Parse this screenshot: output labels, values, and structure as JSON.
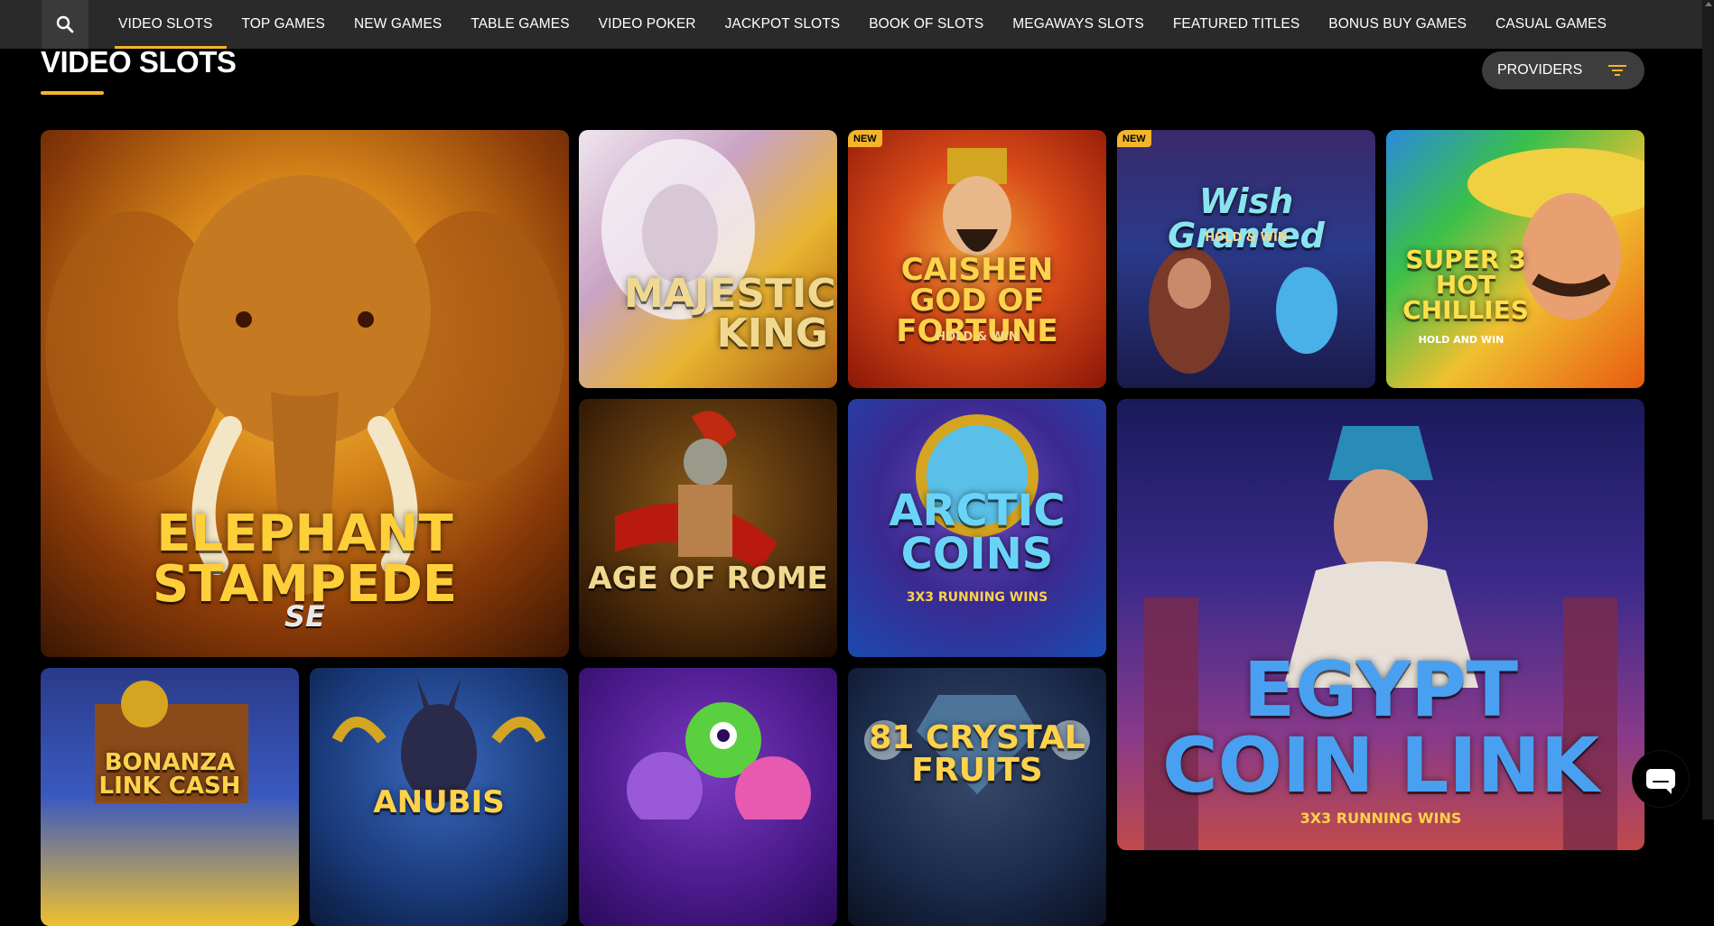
{
  "nav": {
    "search_icon": "search-icon",
    "items": [
      {
        "label": "VIDEO SLOTS"
      },
      {
        "label": "TOP GAMES"
      },
      {
        "label": "NEW GAMES"
      },
      {
        "label": "TABLE GAMES"
      },
      {
        "label": "VIDEO POKER"
      },
      {
        "label": "JACKPOT SLOTS"
      },
      {
        "label": "BOOK OF SLOTS"
      },
      {
        "label": "MEGAWAYS SLOTS"
      },
      {
        "label": "FEATURED TITLES"
      },
      {
        "label": "BONUS BUY GAMES"
      },
      {
        "label": "CASUAL GAMES"
      }
    ],
    "active_index": 0
  },
  "page": {
    "title": "VIDEO SLOTS",
    "providers_label": "PROVIDERS",
    "providers_icon": "filter-icon"
  },
  "colors": {
    "accent": "#f5b52a",
    "nav_bg": "#2a2a2a",
    "page_bg": "#000000",
    "pill_bg": "#3d3d3d"
  },
  "games": [
    {
      "name": "ELEPHANT STAMPEDE",
      "sub": "SE",
      "badge": ""
    },
    {
      "name": "MAJESTIC KING",
      "sub": "",
      "badge": ""
    },
    {
      "name": "CAISHEN GOD OF FORTUNE",
      "sub": "HOLD & WIN",
      "badge": "NEW"
    },
    {
      "name": "Wish Granted",
      "sub": "HOLD & WIN",
      "badge": "NEW"
    },
    {
      "name": "SUPER 3 HOT CHILLIES",
      "sub": "HOLD AND WIN",
      "badge": ""
    },
    {
      "name": "AGE OF ROME",
      "sub": "",
      "badge": ""
    },
    {
      "name": "ARCTIC COINS",
      "sub": "3X3 RUNNING WINS",
      "badge": ""
    },
    {
      "name": "EGYPT COIN LINK",
      "sub": "3X3 RUNNING WINS",
      "badge": ""
    },
    {
      "name": "BONANZA LINK CASH",
      "sub": "",
      "badge": ""
    },
    {
      "name": "ANUBIS",
      "sub": "",
      "badge": ""
    },
    {
      "name": "",
      "sub": "",
      "badge": ""
    },
    {
      "name": "81 CRYSTAL FRUITS",
      "sub": "",
      "badge": ""
    }
  ],
  "chat": {
    "icon": "chat-icon"
  }
}
